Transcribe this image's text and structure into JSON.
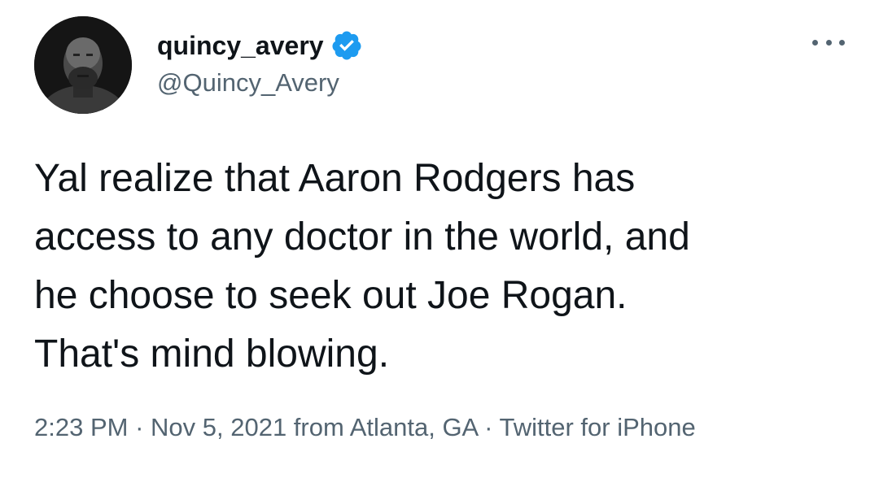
{
  "author": {
    "display_name": "quincy_avery",
    "handle": "@Quincy_Avery",
    "verified": true,
    "avatar_icon": "profile-photo",
    "badge_color": "#1d9bf0"
  },
  "more_icon": "more-horizontal-icon",
  "tweet": {
    "text": "Yal realize that Aaron Rodgers has\naccess to any doctor in the world, and\nhe choose to seek out Joe Rogan.\nThat's mind blowing."
  },
  "meta": {
    "time": "2:23 PM",
    "separator": " · ",
    "date": "Nov 5, 2021",
    "location": " from Atlanta, GA",
    "source": "Twitter for iPhone"
  },
  "colors": {
    "text": "#0f1419",
    "secondary": "#536471",
    "accent": "#1d9bf0"
  }
}
